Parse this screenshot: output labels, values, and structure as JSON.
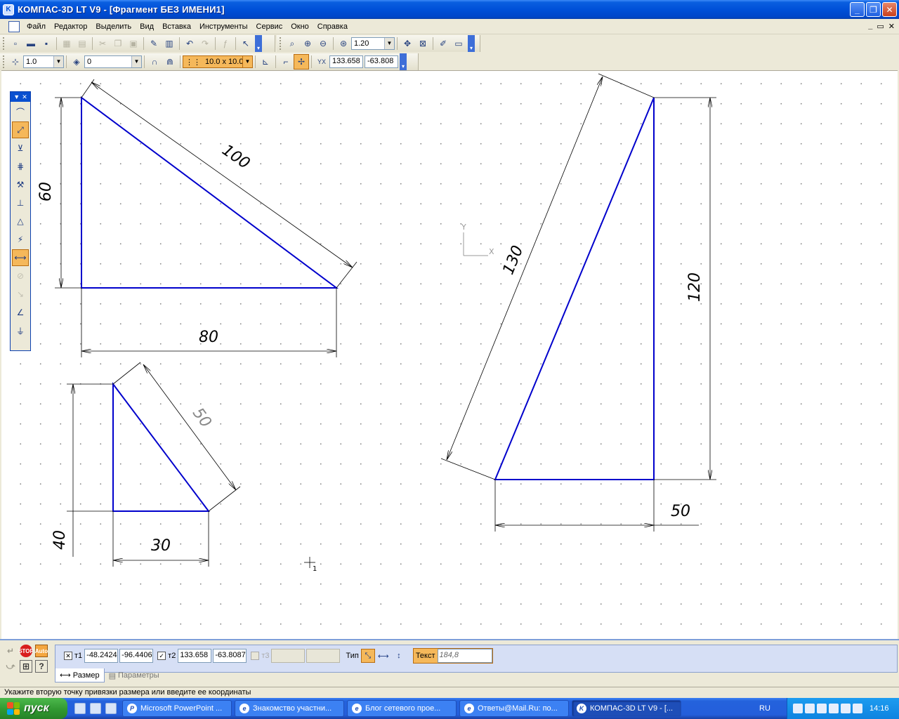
{
  "window": {
    "title": "КОМПАС-3D LT V9 - [Фрагмент БЕЗ ИМЕНИ1]",
    "controls": [
      "_",
      "❐",
      "✕"
    ]
  },
  "menu": {
    "items": [
      "Файл",
      "Редактор",
      "Выделить",
      "Вид",
      "Вставка",
      "Инструменты",
      "Сервис",
      "Окно",
      "Справка"
    ],
    "mdi_controls": [
      "_",
      "▭",
      "✕"
    ]
  },
  "toolbar": {
    "zoom_value": "1.20",
    "line_scale": "1.0",
    "layer": "0",
    "grid_step": "10.0 x 10.0",
    "coord_x": "133.658",
    "coord_y": "-63.808"
  },
  "drawing": {
    "dimensions": [
      "100",
      "60",
      "80",
      "50",
      "40",
      "30",
      "130",
      "120",
      "50"
    ],
    "axis_x": "X",
    "axis_y": "Y",
    "cursor_label": "1"
  },
  "properties": {
    "t1_label": "т1",
    "t1_x": "-48.2424",
    "t1_y": "-96.4406",
    "t2_label": "т2",
    "t2_x": "133.658",
    "t2_y": "-63.8087",
    "t3_label": "т3",
    "type_label": "Тип",
    "text_label": "Текст",
    "text_value": "184,8",
    "tabs": [
      "Размер",
      "Параметры"
    ]
  },
  "status": {
    "message": "Укажите вторую точку привязки размера или введите ее координаты"
  },
  "taskbar": {
    "start_label": "пуск",
    "tasks": [
      "Microsoft PowerPoint ...",
      "Знакомство участни...",
      "Блог сетевого прое...",
      "Ответы@Mail.Ru: по...",
      "КОМПАС-3D LT V9 - [..."
    ],
    "language": "RU",
    "clock": "14:16"
  },
  "colors": {
    "geometry": "#0000cc",
    "dimension": "#000000",
    "highlight": "#f5b85a"
  }
}
